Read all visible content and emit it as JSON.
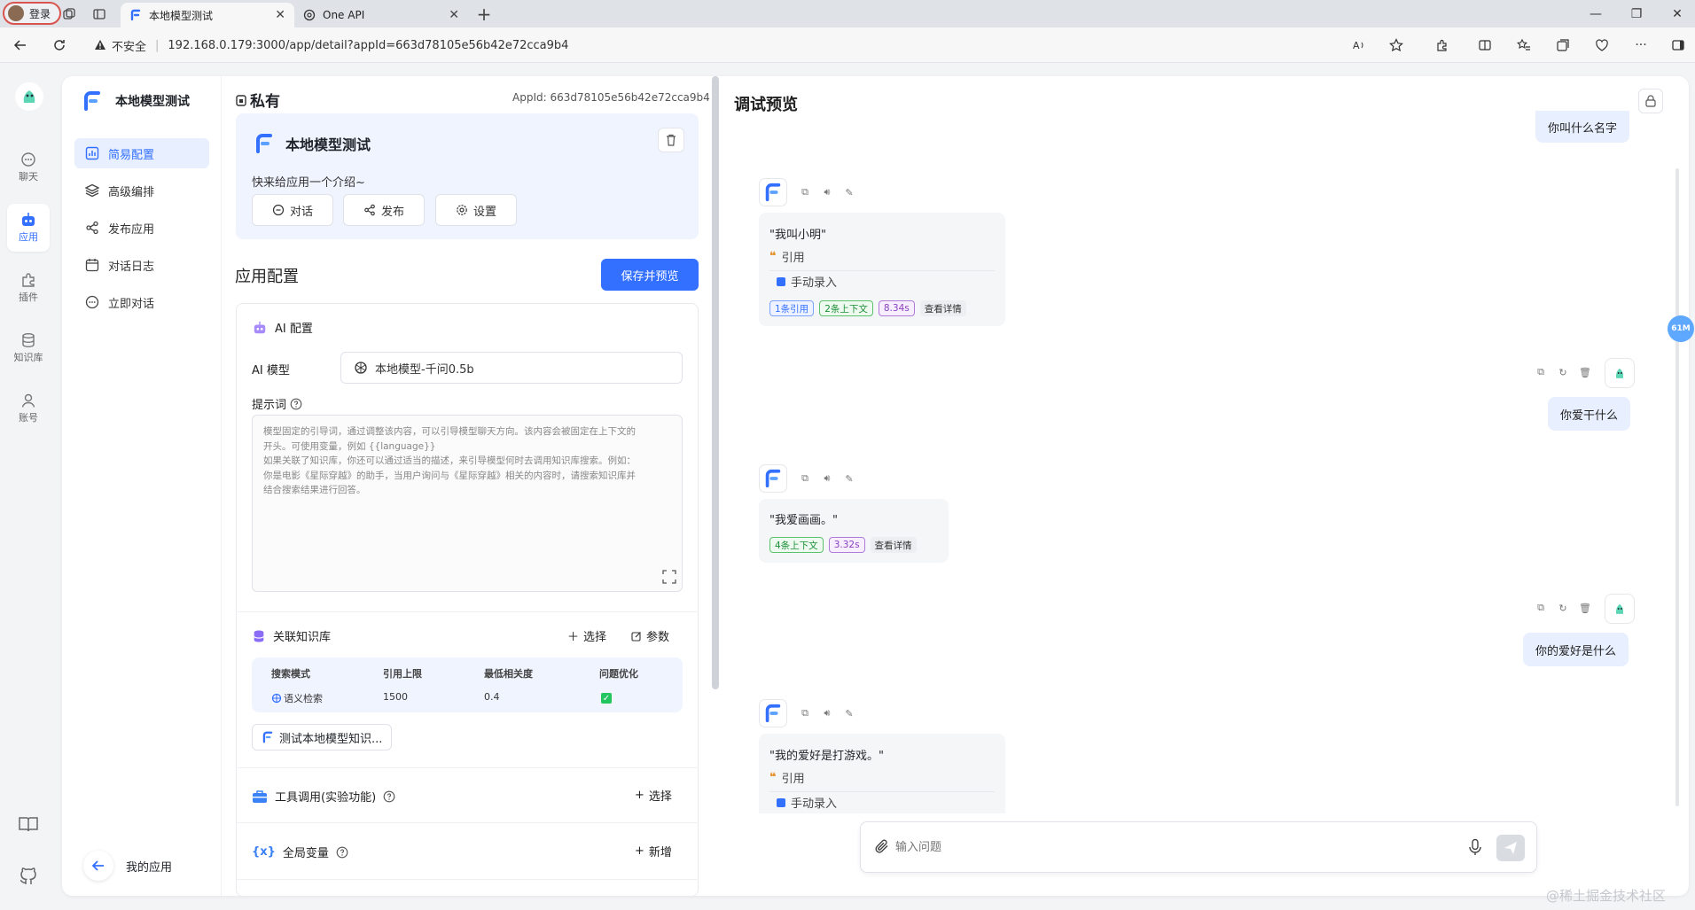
{
  "browser": {
    "profile_label": "登录",
    "tabs": [
      {
        "label": "本地模型测试",
        "active": true
      },
      {
        "label": "One API",
        "active": false
      }
    ],
    "security_label": "不安全",
    "url": "192.168.0.179:3000/app/detail?appId=663d78105e56b42e72cca9b4"
  },
  "rail": {
    "items": [
      {
        "label": "聊天",
        "icon": "chat-icon"
      },
      {
        "label": "应用",
        "icon": "robot-icon",
        "active": true
      },
      {
        "label": "插件",
        "icon": "puzzle-icon"
      },
      {
        "label": "知识库",
        "icon": "database-icon"
      },
      {
        "label": "账号",
        "icon": "user-icon"
      }
    ]
  },
  "sidenav": {
    "app_name": "本地模型测试",
    "items": [
      {
        "label": "简易配置",
        "active": true
      },
      {
        "label": "高级编排"
      },
      {
        "label": "发布应用"
      },
      {
        "label": "对话日志"
      },
      {
        "label": "立即对话"
      }
    ],
    "back_label": "我的应用"
  },
  "config": {
    "private_label": "私有",
    "appid_text": "AppId: 663d78105e56b42e72cca9b4",
    "app_name": "本地模型测试",
    "intro": "快来给应用一个介绍~",
    "buttons": {
      "chat": "对话",
      "publish": "发布",
      "settings": "设置"
    },
    "section_title": "应用配置",
    "save_label": "保存并预览",
    "ai_config_title": "AI 配置",
    "model_label": "AI 模型",
    "model_value": "本地模型-千问0.5b",
    "prompt_label": "提示词",
    "prompt_placeholder_lines": [
      "模型固定的引导词，通过调整该内容，可以引导模型聊天方向。该内容会被固定在上下文的",
      "开头。可使用变量，例如 {{language}}",
      "如果关联了知识库，你还可以通过适当的描述，来引导模型何时去调用知识库搜索。例如：",
      "你是电影《星际穿越》的助手，当用户询问与《星际穿越》相关的内容时，请搜索知识库并",
      "结合搜索结果进行回答。"
    ],
    "kb": {
      "title": "关联知识库",
      "select_label": "选择",
      "params_label": "参数",
      "headers": [
        "搜索模式",
        "引用上限",
        "最低相关度",
        "问题优化"
      ],
      "row": {
        "mode": "语义检索",
        "limit": "1500",
        "similarity": "0.4"
      },
      "dataset_chip": "测试本地模型知识..."
    },
    "tools": {
      "title": "工具调用(实验功能)",
      "select_label": "选择"
    },
    "vars": {
      "title": "全局变量",
      "add_label": "新增"
    }
  },
  "preview": {
    "title": "调试预览",
    "messages": {
      "u1": "你叫什么名字",
      "b1": "\"我叫小明\"",
      "quote_label": "引用",
      "manual_label": "手动录入",
      "b1_tags": {
        "cite": "1条引用",
        "ctx": "2条上下文",
        "time": "8.34s",
        "detail": "查看详情"
      },
      "u2": "你爱干什么",
      "b2": "\"我爱画画。\"",
      "b2_tags": {
        "ctx": "4条上下文",
        "time": "3.32s",
        "detail": "查看详情"
      },
      "u3": "你的爱好是什么",
      "b3": "\"我的爱好是打游戏。\""
    },
    "input_placeholder": "输入问题",
    "float_badge": "61M"
  },
  "watermark": "@稀土掘金技术社区",
  "colors": {
    "accent": "#3370ff",
    "user_bubble": "#e8efff",
    "check_green": "#22c55e"
  }
}
